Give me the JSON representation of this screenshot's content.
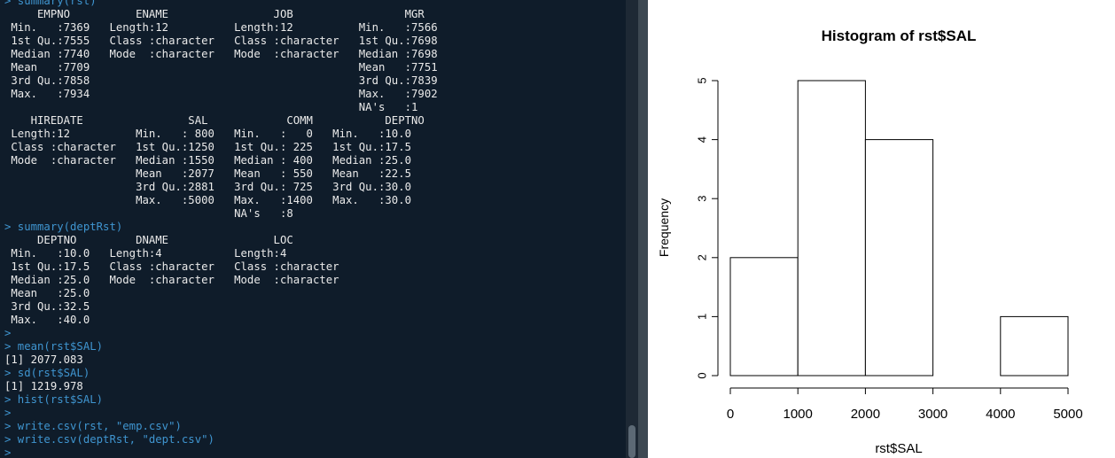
{
  "console": {
    "lines": [
      {
        "text": "> summary(rst)",
        "cmd": true
      },
      {
        "text": "     EMPNO          ENAME                JOB                 MGR",
        "cmd": false
      },
      {
        "text": " Min.   :7369   Length:12          Length:12          Min.   :7566",
        "cmd": false
      },
      {
        "text": " 1st Qu.:7555   Class :character   Class :character   1st Qu.:7698",
        "cmd": false
      },
      {
        "text": " Median :7740   Mode  :character   Mode  :character   Median :7698",
        "cmd": false
      },
      {
        "text": " Mean   :7709                                         Mean   :7751",
        "cmd": false
      },
      {
        "text": " 3rd Qu.:7858                                         3rd Qu.:7839",
        "cmd": false
      },
      {
        "text": " Max.   :7934                                         Max.   :7902",
        "cmd": false
      },
      {
        "text": "                                                      NA's   :1",
        "cmd": false
      },
      {
        "text": "    HIREDATE                SAL            COMM           DEPTNO",
        "cmd": false
      },
      {
        "text": " Length:12          Min.   : 800   Min.   :   0   Min.   :10.0",
        "cmd": false
      },
      {
        "text": " Class :character   1st Qu.:1250   1st Qu.: 225   1st Qu.:17.5",
        "cmd": false
      },
      {
        "text": " Mode  :character   Median :1550   Median : 400   Median :25.0",
        "cmd": false
      },
      {
        "text": "                    Mean   :2077   Mean   : 550   Mean   :22.5",
        "cmd": false
      },
      {
        "text": "                    3rd Qu.:2881   3rd Qu.: 725   3rd Qu.:30.0",
        "cmd": false
      },
      {
        "text": "                    Max.   :5000   Max.   :1400   Max.   :30.0",
        "cmd": false
      },
      {
        "text": "                                   NA's   :8",
        "cmd": false
      },
      {
        "text": "> summary(deptRst)",
        "cmd": true
      },
      {
        "text": "     DEPTNO         DNAME                LOC",
        "cmd": false
      },
      {
        "text": " Min.   :10.0   Length:4           Length:4",
        "cmd": false
      },
      {
        "text": " 1st Qu.:17.5   Class :character   Class :character",
        "cmd": false
      },
      {
        "text": " Median :25.0   Mode  :character   Mode  :character",
        "cmd": false
      },
      {
        "text": " Mean   :25.0",
        "cmd": false
      },
      {
        "text": " 3rd Qu.:32.5",
        "cmd": false
      },
      {
        "text": " Max.   :40.0",
        "cmd": false
      },
      {
        "text": ">",
        "cmd": true
      },
      {
        "text": "> mean(rst$SAL)",
        "cmd": true
      },
      {
        "text": "[1] 2077.083",
        "cmd": false
      },
      {
        "text": "> sd(rst$SAL)",
        "cmd": true
      },
      {
        "text": "[1] 1219.978",
        "cmd": false
      },
      {
        "text": "> hist(rst$SAL)",
        "cmd": true
      },
      {
        "text": ">",
        "cmd": true
      },
      {
        "text": "> write.csv(rst, \"emp.csv\")",
        "cmd": true
      },
      {
        "text": "> write.csv(deptRst, \"dept.csv\")",
        "cmd": true
      },
      {
        "text": "> ",
        "cmd": true
      }
    ],
    "colors": {
      "background": "#0f1c2a",
      "output": "#eaeaea",
      "command": "#3f95d0"
    }
  },
  "chart_data": {
    "type": "bar",
    "title": "Histogram of rst$SAL",
    "xlabel": "rst$SAL",
    "ylabel": "Frequency",
    "bins": [
      {
        "from": 0,
        "to": 1000,
        "count": 2
      },
      {
        "from": 1000,
        "to": 2000,
        "count": 5
      },
      {
        "from": 2000,
        "to": 3000,
        "count": 4
      },
      {
        "from": 3000,
        "to": 4000,
        "count": 0
      },
      {
        "from": 4000,
        "to": 5000,
        "count": 1
      }
    ],
    "xlim": [
      0,
      5000
    ],
    "ylim": [
      0,
      5
    ],
    "xticks": [
      "0",
      "1000",
      "2000",
      "3000",
      "4000",
      "5000"
    ],
    "yticks": [
      "0",
      "1",
      "2",
      "3",
      "4",
      "5"
    ],
    "grid": false,
    "legend": "none"
  }
}
